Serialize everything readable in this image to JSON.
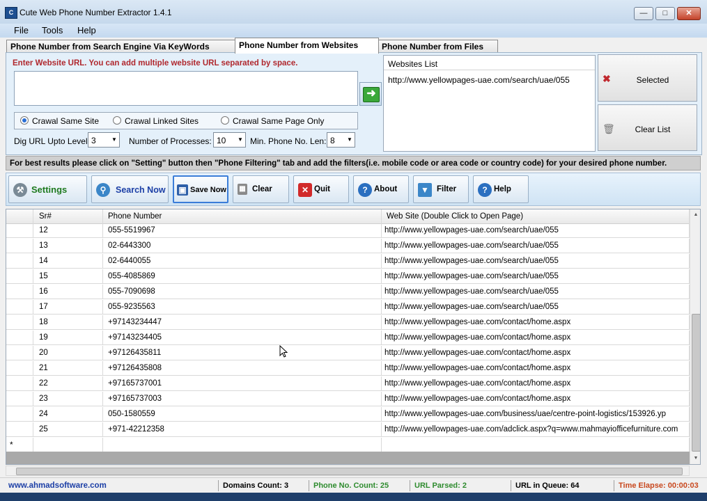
{
  "window": {
    "title": "Cute Web Phone Number Extractor 1.4.1",
    "icon": "app-icon"
  },
  "menu": [
    "File",
    "Tools",
    "Help"
  ],
  "tabs": [
    {
      "label": "Phone Number from Search Engine Via KeyWords",
      "active": false
    },
    {
      "label": "Phone Number from Websites",
      "active": true
    },
    {
      "label": "Phone Number from Files",
      "active": false
    }
  ],
  "url_panel": {
    "label": "Enter Website URL. You can add multiple website URL separated by space.",
    "value": "",
    "radios": [
      {
        "label": "Crawal Same Site",
        "checked": true
      },
      {
        "label": "Crawal Linked Sites",
        "checked": false
      },
      {
        "label": "Crawal Same Page Only",
        "checked": false
      }
    ],
    "dig_label": "Dig URL Upto Level:",
    "dig_value": "3",
    "proc_label": "Number of Processes:",
    "proc_value": "10",
    "minlen_label": "Min. Phone No. Len:",
    "minlen_value": "8"
  },
  "websites": {
    "header": "Websites List",
    "items": [
      "http://www.yellowpages-uae.com/search/uae/055"
    ]
  },
  "side_buttons": {
    "selected": "Selected",
    "clear_list": "Clear List"
  },
  "info_text": "For best results please click on \"Setting\" button then \"Phone Filtering\" tab and add the filters(i.e. mobile code or area code or country code) for your desired phone number.",
  "toolbar": {
    "settings": "Settings",
    "search_now": "Search Now",
    "save_now": "Save Now",
    "clear": "Clear",
    "quit": "Quit",
    "about": "About",
    "filter": "Filter",
    "help": "Help"
  },
  "grid": {
    "columns": [
      "Sr#",
      "Phone Number",
      "Web Site (Double Click to Open Page)"
    ],
    "rows": [
      [
        "12",
        "055-5519967",
        "http://www.yellowpages-uae.com/search/uae/055"
      ],
      [
        "13",
        "02-6443300",
        "http://www.yellowpages-uae.com/search/uae/055"
      ],
      [
        "14",
        "02-6440055",
        "http://www.yellowpages-uae.com/search/uae/055"
      ],
      [
        "15",
        "055-4085869",
        "http://www.yellowpages-uae.com/search/uae/055"
      ],
      [
        "16",
        "055-7090698",
        "http://www.yellowpages-uae.com/search/uae/055"
      ],
      [
        "17",
        "055-9235563",
        "http://www.yellowpages-uae.com/search/uae/055"
      ],
      [
        "18",
        "+97143234447",
        "http://www.yellowpages-uae.com/contact/home.aspx"
      ],
      [
        "19",
        "+97143234405",
        "http://www.yellowpages-uae.com/contact/home.aspx"
      ],
      [
        "20",
        "+97126435811",
        "http://www.yellowpages-uae.com/contact/home.aspx"
      ],
      [
        "21",
        "+97126435808",
        "http://www.yellowpages-uae.com/contact/home.aspx"
      ],
      [
        "22",
        "+97165737001",
        "http://www.yellowpages-uae.com/contact/home.aspx"
      ],
      [
        "23",
        "+97165737003",
        "http://www.yellowpages-uae.com/contact/home.aspx"
      ],
      [
        "24",
        "050-1580559",
        "http://www.yellowpages-uae.com/business/uae/centre-point-logistics/153926.yp"
      ],
      [
        "25",
        "+971-42212358",
        "http://www.yellowpages-uae.com/adclick.aspx?q=www.mahmayiofficefurniture.com"
      ]
    ],
    "new_row_marker": "*"
  },
  "status": {
    "site": "www.ahmadsoftware.com",
    "domains": "Domains Count: 3",
    "phones": "Phone No. Count: 25",
    "parsed": "URL Parsed: 2",
    "queue": "URL in Queue: 64",
    "elapsed": "Time Elapse: 00:00:03"
  },
  "colors": {
    "url_label": "#b0282e",
    "site_link": "#1c3fa6",
    "phone_count": "#2e8b2e",
    "url_parsed": "#2e8b2e",
    "time_elapse": "#c8481e"
  }
}
